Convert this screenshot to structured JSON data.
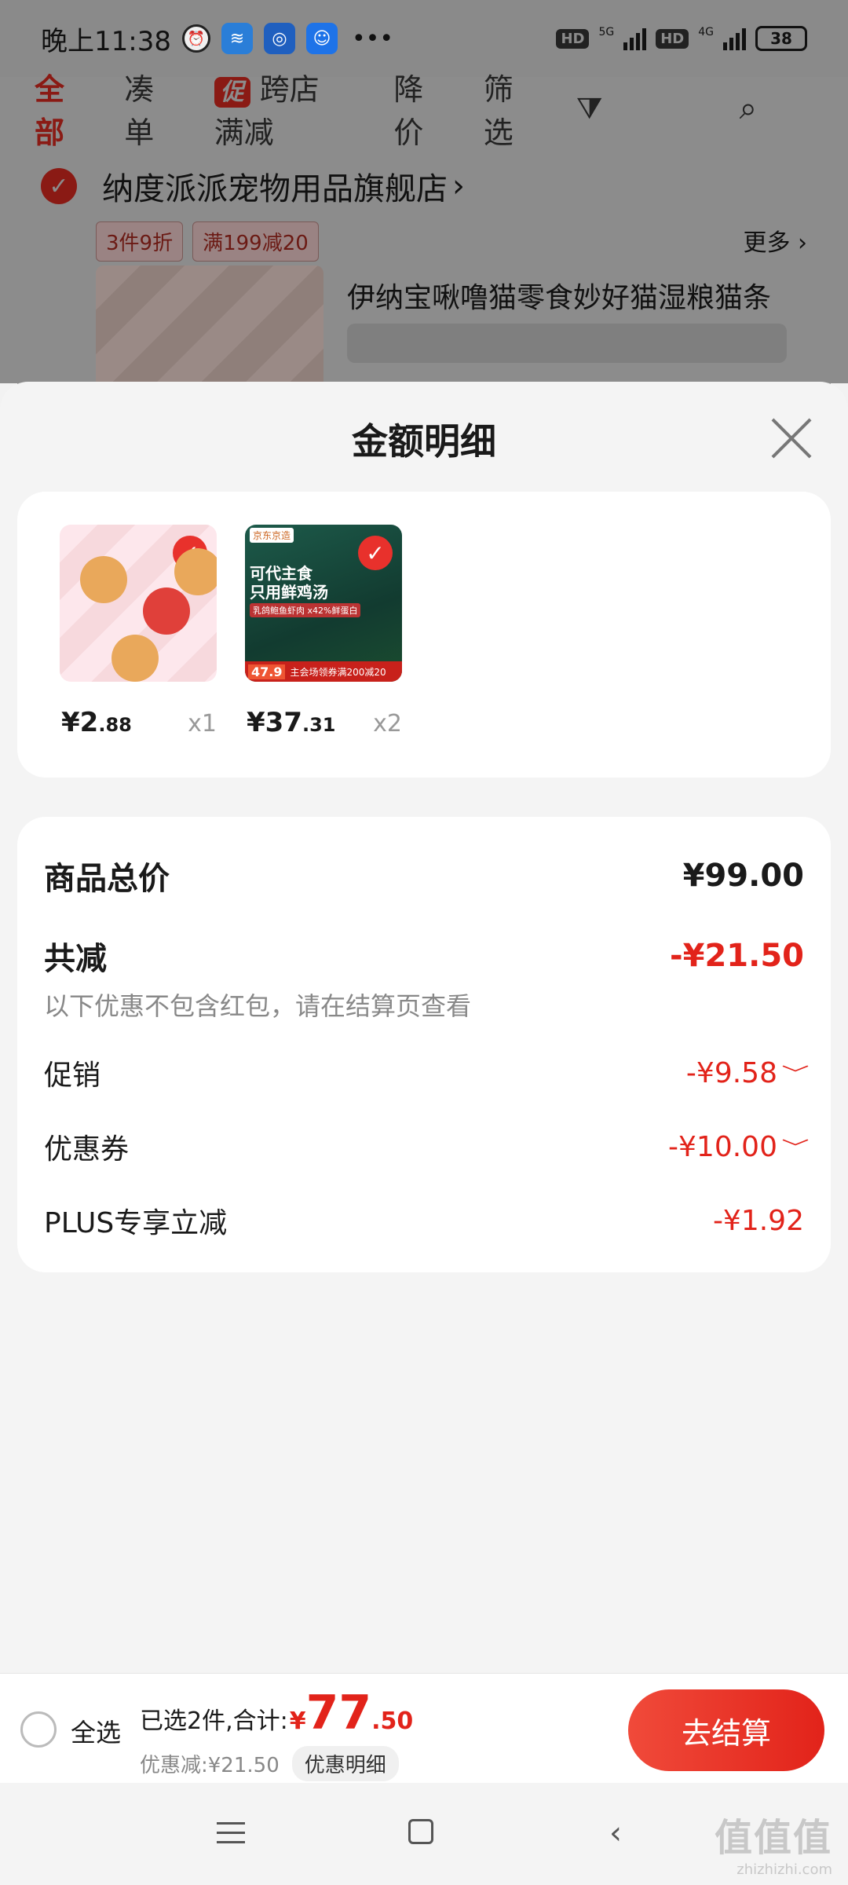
{
  "status_bar": {
    "time": "晚上11:38",
    "network_1": "5G",
    "network_2": "4G",
    "hd": "HD",
    "battery": "38"
  },
  "background": {
    "tabs": [
      "全部",
      "凑单",
      "跨店满减",
      "降价",
      "筛选"
    ],
    "promo_badge": "促",
    "store_name": "纳度派派宠物用品旗舰店",
    "promo_chips": [
      "3件9折",
      "满199减20"
    ],
    "more_label": "更多",
    "product_title": "伊纳宝啾噜猫零食妙好猫湿粮猫条"
  },
  "sheet": {
    "title": "金额明细",
    "products": [
      {
        "price_int": "¥2",
        "price_dec": ".88",
        "qty": "x1"
      },
      {
        "price_int": "¥37",
        "price_dec": ".31",
        "qty": "x2",
        "image_text": {
          "brand": "京东京造",
          "line1": "可代主食",
          "line2": "只用鲜鸡汤",
          "line3": "乳鸽鲍鱼虾肉 x42%鲜蛋白",
          "price": "47.9",
          "promo": "主会场领券满200减20"
        }
      }
    ],
    "summary": {
      "total_label": "商品总价",
      "total_value": "¥99.00",
      "reduce_label": "共减",
      "reduce_value": "-¥21.50",
      "note": "以下优惠不包含红包，请在结算页查看",
      "items": [
        {
          "label": "促销",
          "value": "-¥9.58",
          "expandable": true
        },
        {
          "label": "优惠券",
          "value": "-¥10.00",
          "expandable": true
        },
        {
          "label": "PLUS专享立减",
          "value": "-¥1.92",
          "expandable": false
        }
      ]
    }
  },
  "bottom_bar": {
    "select_all": "全选",
    "selected_text": "已选2件,合计:",
    "yen": "¥",
    "total_int": "77",
    "total_dec": ".50",
    "discount_text": "优惠减:¥21.50",
    "detail_button": "优惠明细",
    "checkout_button": "去结算"
  },
  "watermark": {
    "main": "值值值",
    "sub": "zhizhizhi.com"
  },
  "colors": {
    "accent": "#e2231a",
    "sheet_bg": "#f4f4f4"
  }
}
